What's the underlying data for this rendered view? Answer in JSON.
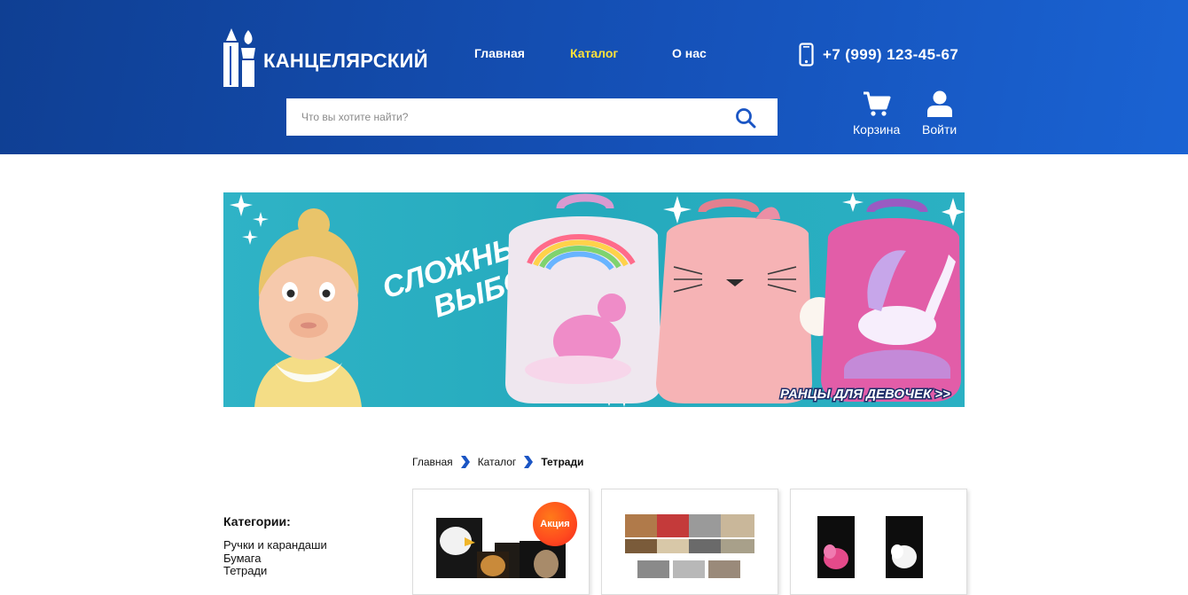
{
  "header": {
    "logo_text": "КАНЦЕЛЯРСКИЙ",
    "nav": [
      {
        "label": "Главная",
        "active": false
      },
      {
        "label": "Каталог",
        "active": true
      },
      {
        "label": "О нас",
        "active": false
      }
    ],
    "phone": "+7 (999) 123-45-67",
    "search": {
      "placeholder": "Что вы хотите найти?",
      "value": ""
    },
    "cart_label": "Корзина",
    "login_label": "Войти"
  },
  "banner": {
    "headline_line1": "СЛОЖНЫЙ",
    "headline_line2": "ВЫБОР",
    "cta": "РАНЦЫ ДЛЯ ДЕВОЧЕК >>"
  },
  "breadcrumb": {
    "items": [
      "Главная",
      "Каталог"
    ],
    "current": "Тетради"
  },
  "sidebar": {
    "title": "Категории:",
    "categories": [
      "Ручки и карандаши",
      "Бумага",
      "Тетради"
    ]
  },
  "products": [
    {
      "badge": "Акция"
    },
    {
      "badge": ""
    },
    {
      "badge": ""
    }
  ],
  "colors": {
    "header_bg": "#1551b8",
    "nav_active": "#ffe23a",
    "accent_blue": "#1a55c4",
    "sale_badge": "#ff4a1e",
    "banner_bg": "#2bb0c3"
  }
}
